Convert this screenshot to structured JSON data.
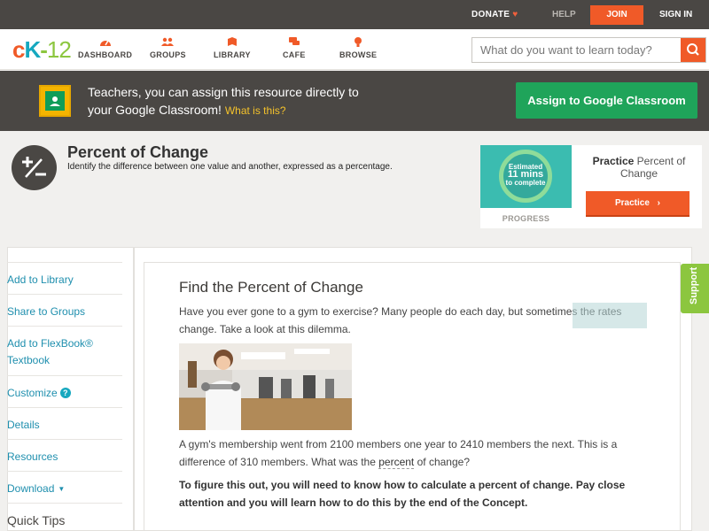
{
  "topbar": {
    "donate": "DONATE",
    "help": "HELP",
    "join": "JOIN",
    "signin": "SIGN IN"
  },
  "brand": {
    "logo_c": "c",
    "logo_k": "K",
    "logo_dash": "-",
    "logo_num": "12",
    "colors": {
      "orange": "#f05a28",
      "teal": "#16a8bf",
      "green": "#8cc63f",
      "dark": "#4a4744"
    }
  },
  "nav": {
    "items": [
      {
        "label": "DASHBOARD",
        "icon": "dashboard-icon"
      },
      {
        "label": "GROUPS",
        "icon": "groups-icon"
      },
      {
        "label": "LIBRARY",
        "icon": "library-icon"
      },
      {
        "label": "CAFE",
        "icon": "cafe-icon"
      },
      {
        "label": "BROWSE",
        "icon": "browse-icon"
      }
    ]
  },
  "search": {
    "placeholder": "What do you want to learn today?",
    "icon": "search-icon"
  },
  "banner": {
    "line1": "Teachers, you can assign this resource directly to",
    "line2": "your Google Classroom!",
    "what": "What is this?",
    "assign": "Assign to Google Classroom",
    "icon": "google-classroom-icon"
  },
  "concept": {
    "title": "Percent of Change",
    "subtitle": "Identify the difference between one value and another, expressed as a percentage.",
    "icon": "plus-minus-icon"
  },
  "practice": {
    "estimated": "Estimated",
    "minutes": "11 mins",
    "to_complete": "to complete",
    "progress": "PROGRESS",
    "title_bold": "Practice",
    "title_rest": "Percent of Change",
    "button": "Practice"
  },
  "sidebar": {
    "items": [
      {
        "label": "Add to Library"
      },
      {
        "label": "Share to Groups"
      },
      {
        "label": "Add to FlexBook® Textbook"
      },
      {
        "label": "Customize"
      },
      {
        "label": "Details"
      },
      {
        "label": "Resources"
      },
      {
        "label": "Download"
      },
      {
        "label": "Quick Tips"
      }
    ],
    "help_glyph": "?",
    "caret": "▼"
  },
  "content": {
    "heading": "Find the Percent of Change",
    "p1": "Have you ever gone to a gym to exercise? Many people do each day, but sometimes the rates change. Take a look at this dilemma.",
    "p2_a": "A gym's membership went from 2100 members one year to 2410 members the next. This is a difference of 310 members. What was the",
    "p2_kw": "percent",
    "p2_b": "of change?",
    "p3": "To figure this out, you will need to know how to calculate a percent of change. Pay close attention and you will learn how to do this by the end of the Concept."
  },
  "support": "Support"
}
